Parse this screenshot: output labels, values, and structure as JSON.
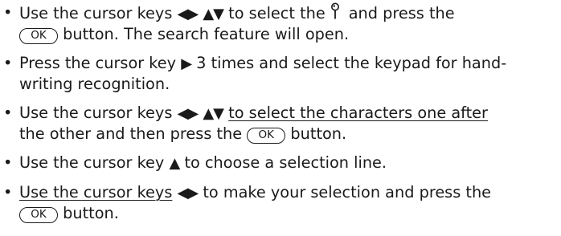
{
  "instructions": [
    {
      "line1": {
        "a": "Use the cursor keys",
        "keys1": "◀▶",
        "keys2": "▲▼",
        "b": "to select the",
        "c": "and press the"
      },
      "line2": {
        "ok": "OK",
        "a": "button. The search feature will open."
      }
    },
    {
      "line1": {
        "a": "Press the cursor key",
        "key": "▶",
        "b": "3 times and select the keypad for hand-"
      },
      "line2": {
        "a": "writing recognition."
      }
    },
    {
      "line1": {
        "a": "Use the cursor keys",
        "keys1": "◀▶",
        "keys2": "▲▼",
        "b": "to select the characters one after"
      },
      "line2": {
        "a": "the other and then press the",
        "ok": "OK",
        "b": "button."
      }
    },
    {
      "line1": {
        "a": "Use the cursor key",
        "key": "▲",
        "b": "to choose a selection line."
      }
    },
    {
      "line1": {
        "a": "Use the cursor keys",
        "keys1": "◀▶",
        "b": "to make your selection and press the"
      },
      "line2": {
        "ok": "OK",
        "a": "button."
      }
    }
  ],
  "bullet": "•",
  "icons": {
    "search": "search-icon"
  }
}
